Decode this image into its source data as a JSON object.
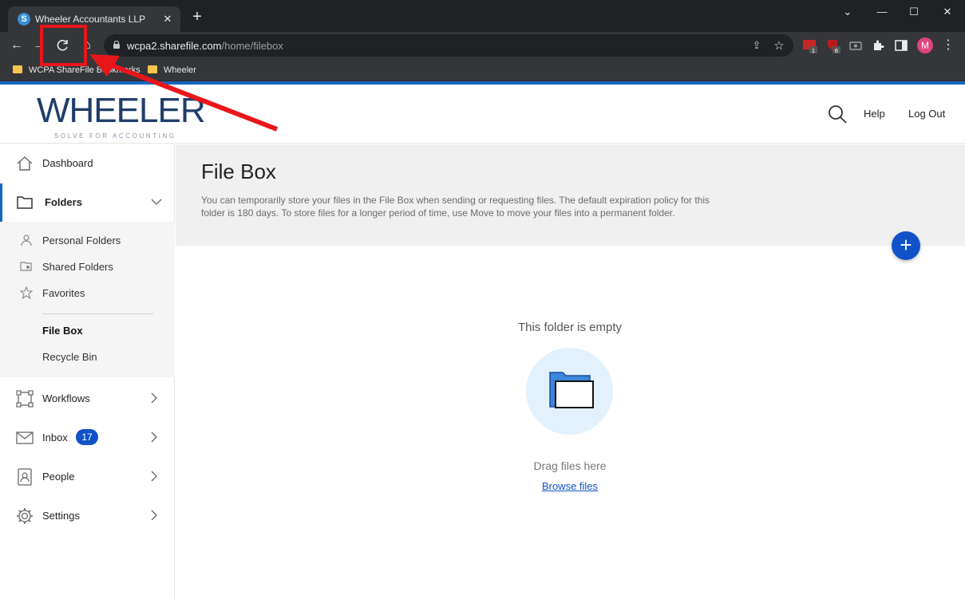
{
  "browser": {
    "tab_title": "Wheeler Accountants LLP",
    "favicon_letter": "S",
    "url_host": "wcpa2.sharefile.com",
    "url_path": "/home/filebox",
    "profile_initial": "M",
    "ext_badges": [
      "1",
      "6"
    ],
    "bookmarks": [
      {
        "label": "WCPA ShareFile Bookmarks"
      },
      {
        "label": "Wheeler"
      }
    ]
  },
  "header": {
    "logo_text": "WHEELER",
    "logo_tagline": "SOLVE FOR ACCOUNTING",
    "help": "Help",
    "logout": "Log Out"
  },
  "sidebar": {
    "dashboard": "Dashboard",
    "folders": "Folders",
    "sub_items": [
      "Personal Folders",
      "Shared Folders",
      "Favorites",
      "File Box",
      "Recycle Bin"
    ],
    "workflows": "Workflows",
    "inbox": "Inbox",
    "inbox_count": "17",
    "people": "People",
    "settings": "Settings"
  },
  "main": {
    "title": "File Box",
    "description": "You can temporarily store your files in the File Box when sending or requesting files. The default expiration policy for this folder is 180 days. To store files for a longer period of time, use Move to move your files into a permanent folder.",
    "empty_title": "This folder is empty",
    "drag_text": "Drag files here",
    "browse_link": "Browse files"
  },
  "colors": {
    "accent": "#1152c8",
    "annotation": "#e8161b",
    "logo": "#1f3d6b"
  }
}
